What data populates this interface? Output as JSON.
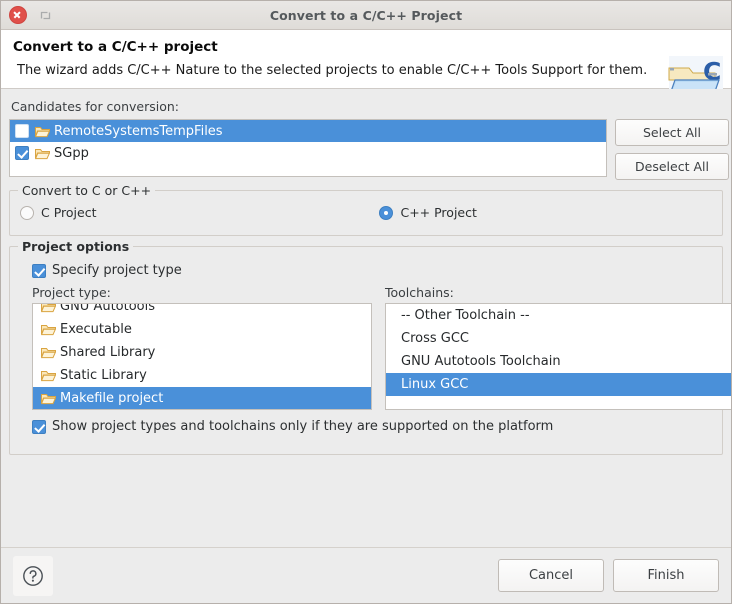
{
  "titlebar": {
    "title": "Convert to a C/C++ Project",
    "close_icon": "close-icon",
    "restore_icon": "restore-icon"
  },
  "banner": {
    "title": "Convert to a C/C++ project",
    "description": "The wizard adds C/C++ Nature to the selected projects to enable C/C++ Tools Support for them.",
    "icon": "c-project-folder-icon"
  },
  "candidates": {
    "label": "Candidates for conversion:",
    "items": [
      {
        "label": "RemoteSystemsTempFiles",
        "checked": false,
        "selected": true
      },
      {
        "label": "SGpp",
        "checked": true,
        "selected": false
      }
    ],
    "select_all_label": "Select All",
    "deselect_all_label": "Deselect All"
  },
  "convert_group": {
    "title": "Convert to C or C++",
    "options": [
      {
        "label": "C Project",
        "selected": false
      },
      {
        "label": "C++ Project",
        "selected": true
      }
    ]
  },
  "project_options": {
    "title": "Project options",
    "specify_label": "Specify project type",
    "specify_checked": true,
    "project_type_label": "Project type:",
    "project_types": [
      {
        "label": "GNU Autotools",
        "selected": false
      },
      {
        "label": "Executable",
        "selected": false
      },
      {
        "label": "Shared Library",
        "selected": false
      },
      {
        "label": "Static Library",
        "selected": false
      },
      {
        "label": "Makefile project",
        "selected": true
      }
    ],
    "toolchains_label": "Toolchains:",
    "toolchains": [
      {
        "label": "-- Other Toolchain --",
        "selected": false
      },
      {
        "label": "Cross GCC",
        "selected": false
      },
      {
        "label": "GNU Autotools Toolchain",
        "selected": false
      },
      {
        "label": "Linux GCC",
        "selected": true
      }
    ],
    "platform_filter_label": "Show project types and toolchains only if they are supported on the platform",
    "platform_filter_checked": true
  },
  "footer": {
    "help_icon": "help-icon",
    "cancel_label": "Cancel",
    "finish_label": "Finish"
  },
  "colors": {
    "selection_blue": "#4a90d9",
    "window_bg": "#ececec",
    "list_bg": "#ffffff",
    "close_red": "#e0504a",
    "folder_orange": "#f0a830"
  }
}
